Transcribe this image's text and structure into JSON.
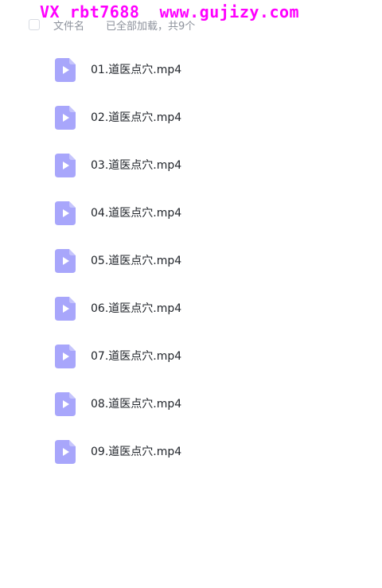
{
  "watermark": "VX rbt7688  www.gujizy.com",
  "header": {
    "column_name": "文件名",
    "load_status": "已全部加载，共9个"
  },
  "icon": "video-file-icon",
  "colors": {
    "watermark": "#ff00ff",
    "icon_fill": "#a8a6fb",
    "text": "#1f2329",
    "muted": "#8d929c"
  },
  "files": [
    {
      "name": "01.道医点穴.mp4"
    },
    {
      "name": "02.道医点穴.mp4"
    },
    {
      "name": "03.道医点穴.mp4"
    },
    {
      "name": "04.道医点穴.mp4"
    },
    {
      "name": "05.道医点穴.mp4"
    },
    {
      "name": "06.道医点穴.mp4"
    },
    {
      "name": "07.道医点穴.mp4"
    },
    {
      "name": "08.道医点穴.mp4"
    },
    {
      "name": "09.道医点穴.mp4"
    }
  ]
}
